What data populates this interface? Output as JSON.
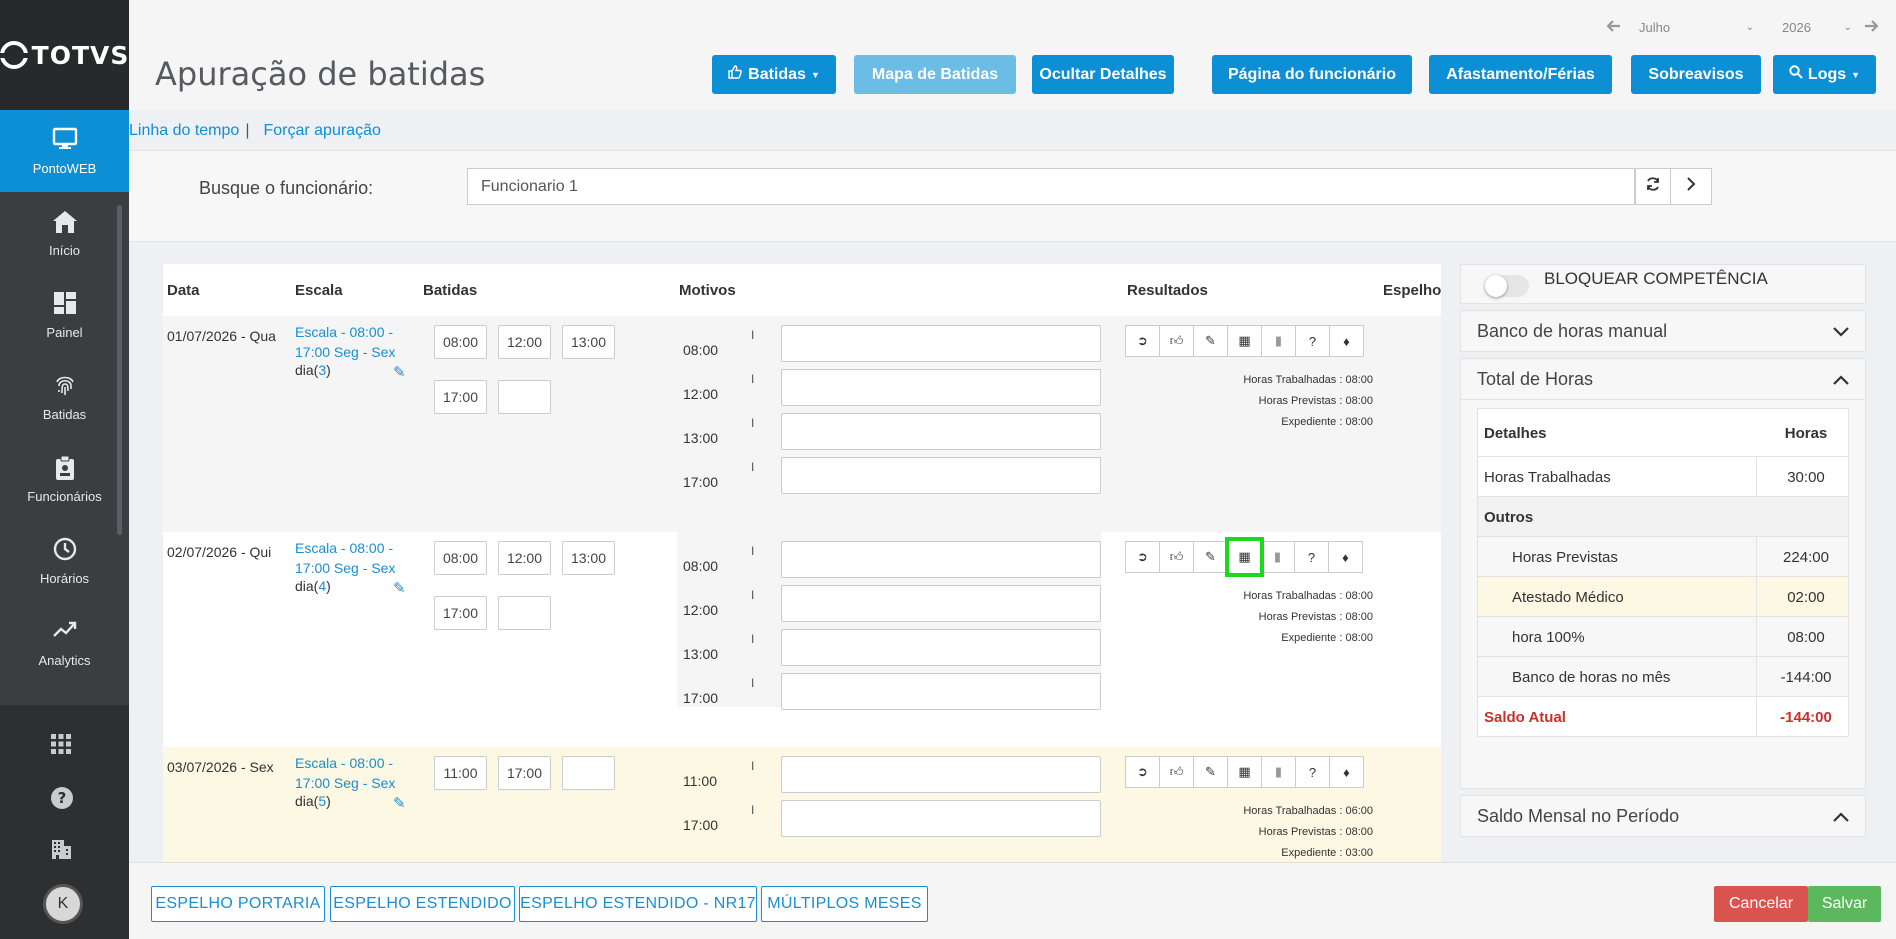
{
  "brand": "TOTVS",
  "sidebar": {
    "items": [
      {
        "label": "PontoWEB",
        "icon": "monitor-icon"
      },
      {
        "label": "Início",
        "icon": "home-icon"
      },
      {
        "label": "Painel",
        "icon": "dashboard-icon"
      },
      {
        "label": "Batidas",
        "icon": "fingerprint-icon"
      },
      {
        "label": "Funcionários",
        "icon": "clipboard-icon"
      },
      {
        "label": "Horários",
        "icon": "clock-icon"
      },
      {
        "label": "Analytics",
        "icon": "trending-icon"
      }
    ],
    "avatar_initial": "K"
  },
  "header": {
    "title": "Apuração de batidas",
    "month": "Julho",
    "year": "2026",
    "buttons": {
      "batidas": "Batidas",
      "mapa": "Mapa de Batidas",
      "ocultar": "Ocultar Detalhes",
      "pagina": "Página do funcionário",
      "afastamento": "Afastamento/Férias",
      "sobreavisos": "Sobreavisos",
      "logs": "Logs"
    }
  },
  "links": {
    "timeline": "Linha do tempo",
    "separator": "|",
    "force": "Forçar apuração"
  },
  "search": {
    "label": "Busque o funcionário:",
    "value": "Funcionario 1"
  },
  "table": {
    "headers": {
      "data": "Data",
      "escala": "Escala",
      "batidas": "Batidas",
      "motivos": "Motivos",
      "resultados": "Resultados",
      "espelho": "Espelho"
    },
    "rows": [
      {
        "date": "01/07/2026 - Qua",
        "escala_l1": "Escala - 08:00 -",
        "escala_l2": "17:00 Seg - Sex",
        "dia_prefix": "dia(",
        "dia_num": "3",
        "dia_suffix": ")",
        "batidas": [
          "08:00",
          "12:00",
          "13:00",
          "17:00",
          ""
        ],
        "motivos": [
          "08:00",
          "12:00",
          "13:00",
          "17:00"
        ],
        "bar": "I",
        "res1": "Horas Trabalhadas : 08:00",
        "res2": "Horas Previstas : 08:00",
        "res3": "Expediente : 08:00"
      },
      {
        "date": "02/07/2026 - Qui",
        "escala_l1": "Escala - 08:00 -",
        "escala_l2": "17:00 Seg - Sex",
        "dia_prefix": "dia(",
        "dia_num": "4",
        "dia_suffix": ")",
        "batidas": [
          "08:00",
          "12:00",
          "13:00",
          "17:00",
          ""
        ],
        "motivos": [
          "08:00",
          "12:00",
          "13:00",
          "17:00"
        ],
        "bar": "I",
        "res1": "Horas Trabalhadas : 08:00",
        "res2": "Horas Previstas : 08:00",
        "res3": "Expediente : 08:00"
      },
      {
        "date": "03/07/2026 - Sex",
        "escala_l1": "Escala - 08:00 -",
        "escala_l2": "17:00 Seg - Sex",
        "dia_prefix": "dia(",
        "dia_num": "5",
        "dia_suffix": ")",
        "batidas": [
          "11:00",
          "17:00",
          ""
        ],
        "motivos": [
          "11:00",
          "17:00"
        ],
        "bar": "I",
        "res1": "Horas Trabalhadas : 06:00",
        "res2": "Horas Previstas : 08:00",
        "res3": "Expediente : 03:00"
      }
    ]
  },
  "panel": {
    "bloquear": "BLOQUEAR COMPETÊNCIA",
    "banco_manual": "Banco de horas manual",
    "total_horas": "Total de Horas",
    "col_detalhes": "Detalhes",
    "col_horas": "Horas",
    "rows": [
      {
        "label": "Horas Trabalhadas",
        "value": "30:00"
      },
      {
        "label": "Outros",
        "value": ""
      },
      {
        "label": "Horas Previstas",
        "value": "224:00"
      },
      {
        "label": "Atestado Médico",
        "value": "02:00"
      },
      {
        "label": "hora 100%",
        "value": "08:00"
      },
      {
        "label": "Banco de horas no mês",
        "value": "-144:00"
      },
      {
        "label": "Saldo Atual",
        "value": "-144:00"
      }
    ],
    "saldo_mensal": "Saldo Mensal no Período"
  },
  "footer": {
    "espelho_portaria": "ESPELHO PORTARIA",
    "espelho_estendido": "ESPELHO ESTENDIDO",
    "espelho_nr17": "ESPELHO ESTENDIDO - NR17",
    "multiplos": "MÚLTIPLOS MESES",
    "cancelar": "Cancelar",
    "salvar": "Salvar"
  },
  "colors": {
    "primary": "#0d8fd6",
    "sidebar": "#3b3d40",
    "danger": "#d9534f",
    "success": "#5cb85c",
    "highlight": "#1bd81b",
    "saldo": "#c9302c"
  }
}
